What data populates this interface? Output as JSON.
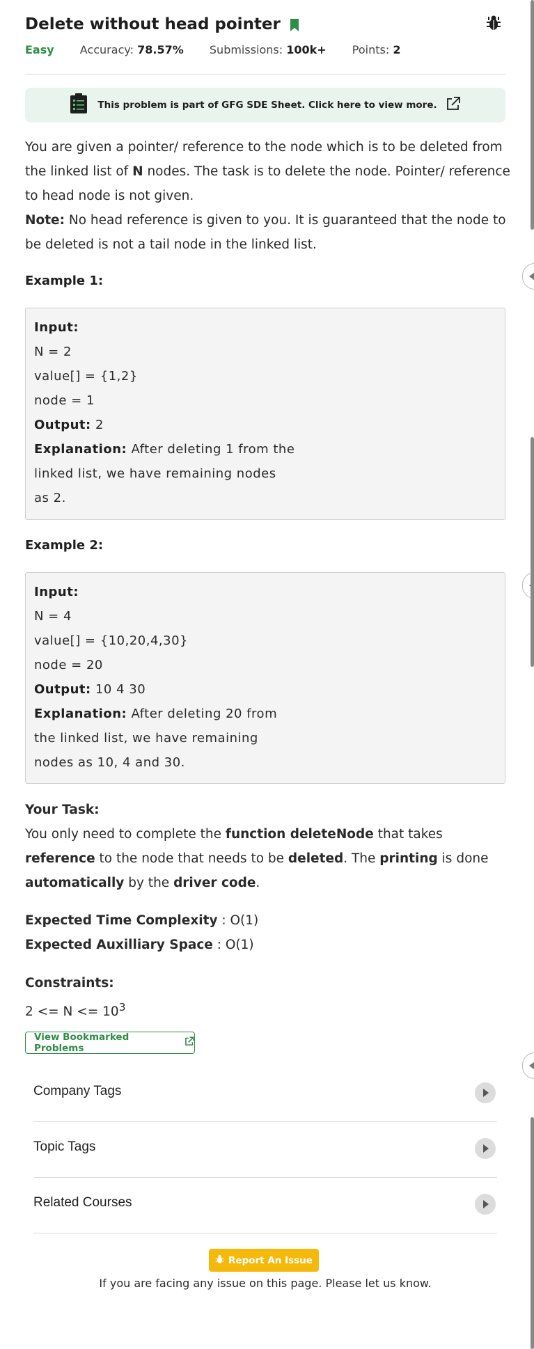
{
  "problem": {
    "title": "Delete without head pointer",
    "difficulty": "Easy",
    "accuracy_label": "Accuracy:",
    "accuracy_value": "78.57%",
    "submissions_label": "Submissions:",
    "submissions_value": "100k+",
    "points_label": "Points:",
    "points_value": "2"
  },
  "banner": {
    "text": "This problem is part of GFG SDE Sheet. Click here to view more."
  },
  "description": {
    "p1_a": "You are given a pointer/ reference to the node which is to be deleted from the linked list of ",
    "p1_b": "N",
    "p1_c": " nodes. The task is to delete the node. Pointer/ reference to head node is not given.",
    "note_label": "Note:",
    "note_text": " No head reference is given to you. It is guaranteed that the node to be deleted is not a tail node in the linked list."
  },
  "examples": [
    {
      "heading": "Example 1:",
      "input_label": "Input:",
      "lines": [
        "N = 2",
        "value[] = {1,2}",
        "node = 1"
      ],
      "output_label": "Output:",
      "output_value": " 2",
      "explanation_label": "Explanation:",
      "explanation_lines": [
        " After deleting 1 from the",
        "linked list, we have remaining nodes",
        "as 2."
      ]
    },
    {
      "heading": "Example 2:",
      "input_label": "Input:",
      "lines": [
        "N = 4",
        "value[] = {10,20,4,30}",
        "node = 20"
      ],
      "output_label": "Output:",
      "output_value": " 10 4 30",
      "explanation_label": "Explanation:",
      "explanation_lines": [
        " After deleting 20 from",
        "the linked list, we have remaining",
        "nodes as 10, 4 and 30."
      ]
    }
  ],
  "task": {
    "heading": "Your Task:",
    "t1": "You only need to complete the ",
    "t2": "function deleteNode",
    "t3": " that takes ",
    "t4": "reference",
    "t5": " to the node that needs to be ",
    "t6": "deleted",
    "t7": ". The ",
    "t8": "printing",
    "t9": " is done ",
    "t10": "automatically",
    "t11": " by the ",
    "t12": "driver code",
    "t13": "."
  },
  "complexity": {
    "time_label": "Expected Time Complexity",
    "time_value": " : O(1)",
    "space_label": "Expected Auxilliary Space",
    "space_value": " : O(1)"
  },
  "constraints": {
    "heading": "Constraints:",
    "text": "2 <= N <= 10",
    "sup": "3"
  },
  "bookmarks_button": "View Bookmarked Problems",
  "accordions": [
    "Company Tags",
    "Topic Tags",
    "Related Courses"
  ],
  "report": {
    "button": "Report An Issue",
    "note": "If you are facing any issue on this page. Please let us know."
  },
  "colors": {
    "accent": "#2f8d46",
    "report": "#f5b90b",
    "banner_bg": "#eaf4ef"
  },
  "icons": [
    "bookmark-icon",
    "bug-icon",
    "clipboard-icon",
    "external-link-icon",
    "caret-right-icon"
  ]
}
